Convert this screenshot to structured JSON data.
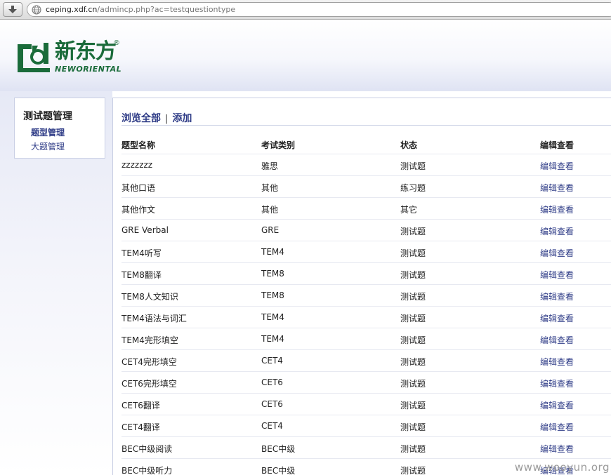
{
  "browser": {
    "url_host": "ceping.xdf.cn",
    "url_path": "/admincp.php?ac=testquestiontype"
  },
  "logo": {
    "cn_text": "新东方",
    "reg_mark": "®",
    "en_text": "NEWORIENTAL",
    "color": "#1a6b3a"
  },
  "sidebar": {
    "title": "测试题管理",
    "items": [
      {
        "label": "题型管理",
        "active": true
      },
      {
        "label": "大题管理",
        "active": false
      }
    ]
  },
  "tabs": {
    "browse_all": "浏览全部",
    "separator": "|",
    "add": "添加"
  },
  "table": {
    "headers": [
      "题型名称",
      "考试类别",
      "状态",
      "编辑查看"
    ],
    "rows": [
      [
        "zzzzzzz",
        "雅思",
        "测试题",
        "编辑查看"
      ],
      [
        "其他口语",
        "其他",
        "练习题",
        "编辑查看"
      ],
      [
        "其他作文",
        "其他",
        "其它",
        "编辑查看"
      ],
      [
        "GRE Verbal",
        "GRE",
        "测试题",
        "编辑查看"
      ],
      [
        "TEM4听写",
        "TEM4",
        "测试题",
        "编辑查看"
      ],
      [
        "TEM8翻译",
        "TEM8",
        "测试题",
        "编辑查看"
      ],
      [
        "TEM8人文知识",
        "TEM8",
        "测试题",
        "编辑查看"
      ],
      [
        "TEM4语法与词汇",
        "TEM4",
        "测试题",
        "编辑查看"
      ],
      [
        "TEM4完形填空",
        "TEM4",
        "测试题",
        "编辑查看"
      ],
      [
        "CET4完形填空",
        "CET4",
        "测试题",
        "编辑查看"
      ],
      [
        "CET6完形填空",
        "CET6",
        "测试题",
        "编辑查看"
      ],
      [
        "CET6翻译",
        "CET6",
        "测试题",
        "编辑查看"
      ],
      [
        "CET4翻译",
        "CET4",
        "测试题",
        "编辑查看"
      ],
      [
        "BEC中级阅读",
        "BEC中级",
        "测试题",
        "编辑查看"
      ],
      [
        "BEC中级听力",
        "BEC中级",
        "测试题",
        "编辑查看"
      ]
    ]
  },
  "watermark": "www.wooyun.org",
  "colors": {
    "link": "#2f3c87",
    "border": "#c9cfe4",
    "brand_green": "#1a6b3a"
  }
}
